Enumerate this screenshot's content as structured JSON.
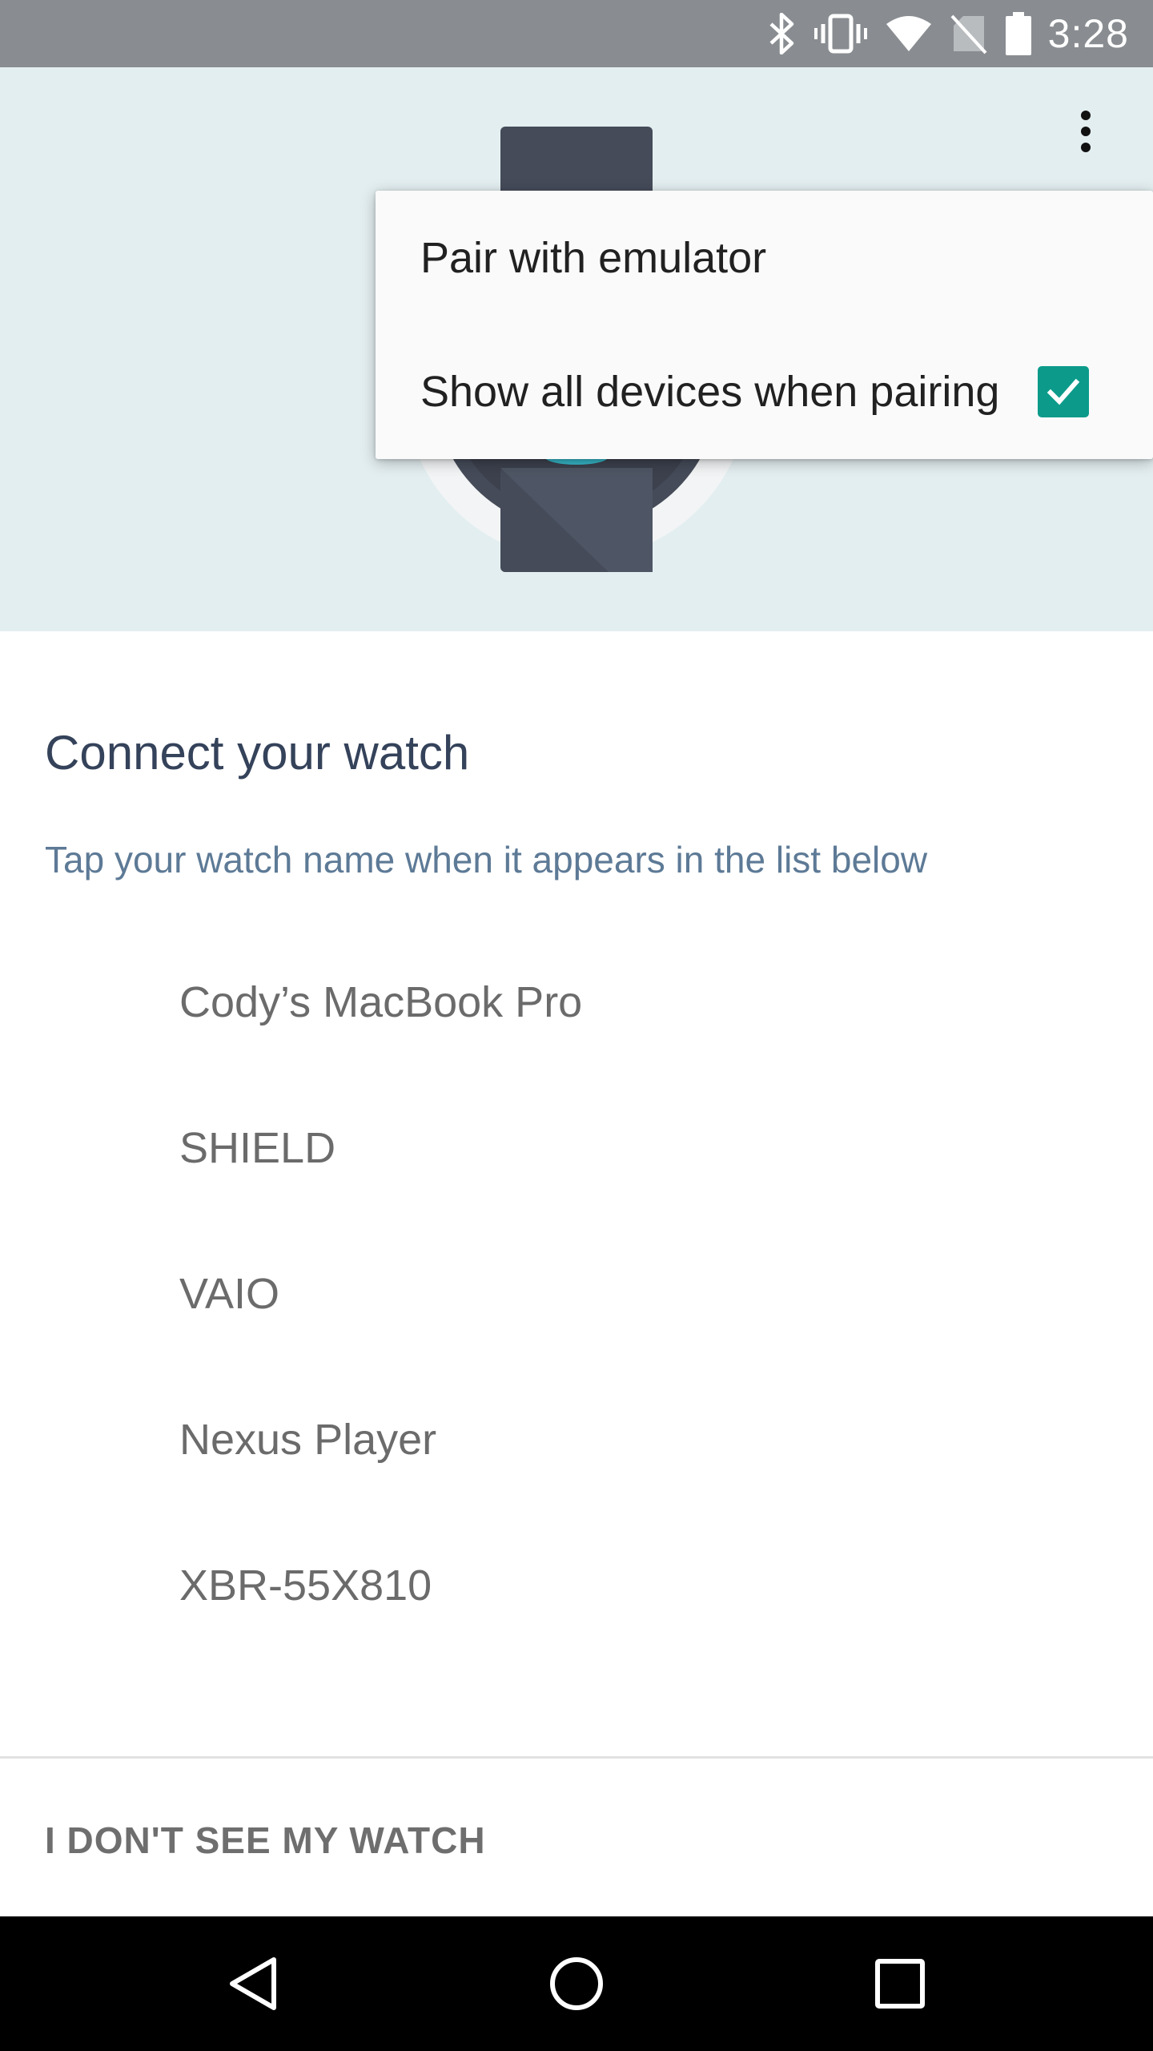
{
  "status_bar": {
    "time": "3:28",
    "icons": [
      "bluetooth-icon",
      "vibrate-icon",
      "wifi-icon",
      "no-sim-icon",
      "battery-icon"
    ]
  },
  "menu": {
    "items": [
      {
        "label": "Pair with emulator"
      },
      {
        "label": "Show all devices when pairing",
        "checked": true
      }
    ]
  },
  "content": {
    "title": "Connect your watch",
    "subtitle": "Tap your watch name when it appears in the list below",
    "devices": [
      {
        "name": "Cody’s MacBook Pro"
      },
      {
        "name": "SHIELD"
      },
      {
        "name": "VAIO"
      },
      {
        "name": "Nexus Player"
      },
      {
        "name": "XBR-55X810"
      }
    ],
    "footer_button": "I DON'T SEE MY WATCH"
  },
  "colors": {
    "status_bar": "#898d91",
    "hero_bg": "#e3eef0",
    "accent": "#0c9b8a",
    "title": "#34425a",
    "subtitle": "#5d7a96"
  }
}
